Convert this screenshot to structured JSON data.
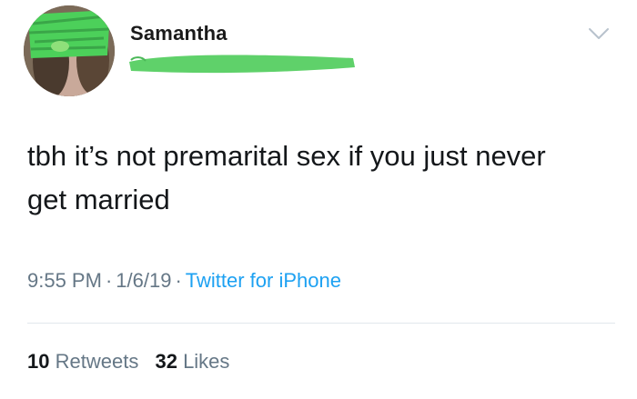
{
  "user": {
    "display_name": "Samantha",
    "avatar_icon": "profile-photo-icon",
    "handle_redaction_color": "#5fd16a"
  },
  "tweet": {
    "text": "tbh it’s not premarital sex if you just never get married"
  },
  "meta": {
    "time": "9:55 PM",
    "date": "1/6/19",
    "source": "Twitter for iPhone",
    "separator": "·"
  },
  "stats": {
    "retweets_count": "10",
    "retweets_label": "Retweets",
    "likes_count": "32",
    "likes_label": "Likes"
  },
  "colors": {
    "link": "#1da1f2",
    "muted": "#657786",
    "divider": "#e1e8ed"
  }
}
